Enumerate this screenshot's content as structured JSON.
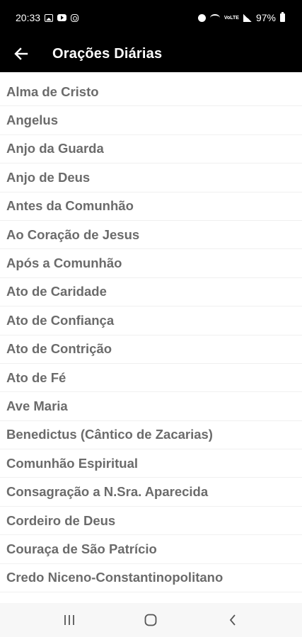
{
  "status_bar": {
    "time": "20:33",
    "lte": "VoLTE",
    "battery": "97%"
  },
  "app_bar": {
    "title": "Orações Diárias"
  },
  "prayers": [
    "Alma de Cristo",
    "Angelus",
    "Anjo da Guarda",
    "Anjo de Deus",
    "Antes da Comunhão",
    "Ao Coração de Jesus",
    "Após a Comunhão",
    "Ato de Caridade",
    "Ato de Confiança",
    "Ato de Contrição",
    "Ato de Fé",
    "Ave Maria",
    "Benedictus (Cântico de Zacarias)",
    "Comunhão Espiritual",
    "Consagração a N.Sra. Aparecida",
    "Cordeiro de Deus",
    "Couraça de São Patrício",
    "Credo Niceno-Constantinopolitano"
  ],
  "colors": {
    "bar_background": "#000000",
    "item_text": "#6b6b6b",
    "nav_background": "#f7f7f7"
  }
}
